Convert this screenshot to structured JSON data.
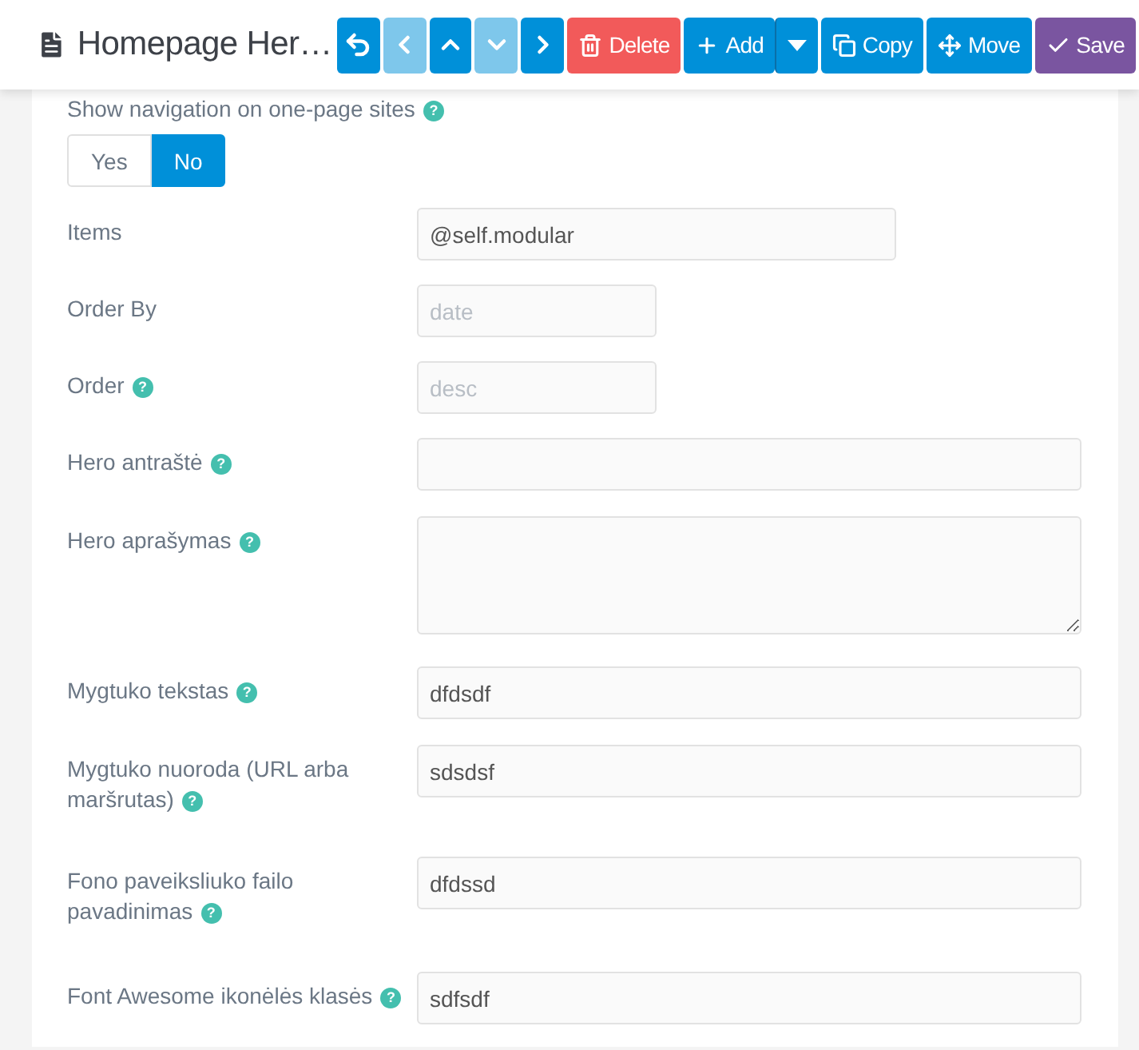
{
  "header": {
    "title": "Homepage Her…"
  },
  "toolbar": [
    {
      "kind": "back",
      "disabled": false
    },
    {
      "kind": "prev",
      "disabled": true
    },
    {
      "kind": "up",
      "disabled": false
    },
    {
      "kind": "down",
      "disabled": true
    },
    {
      "kind": "next",
      "disabled": false
    }
  ],
  "actions": [
    {
      "kind": "delete",
      "label": "Delete"
    },
    {
      "kind": "add",
      "label": "Add"
    },
    {
      "kind": "dropdown"
    },
    {
      "kind": "copy",
      "label": "Copy"
    },
    {
      "kind": "move",
      "label": "Move"
    },
    {
      "kind": "save",
      "label": "Save"
    }
  ],
  "navigation_toggle": {
    "label": "Show navigation on one-page sites",
    "help": "?",
    "options": [
      {
        "label": "Yes",
        "selected": false
      },
      {
        "label": "No",
        "selected": true
      }
    ]
  },
  "fields": [
    {
      "label": "Items",
      "kind": "medium",
      "value": "@self.modular"
    },
    {
      "label": "Order By",
      "kind": "short",
      "placeholder": "date"
    },
    {
      "label": "Order",
      "help": "?",
      "kind": "short",
      "placeholder": "desc"
    },
    {
      "label": "Hero antraštė",
      "help": "?",
      "kind": "wide"
    },
    {
      "label": "Hero aprašymas",
      "help": "?",
      "kind": "textarea"
    },
    {
      "label": "Mygtuko tekstas",
      "help": "?",
      "kind": "wide",
      "value": "dfdsdf"
    },
    {
      "label": "Mygtuko nuoroda (URL arba maršrutas)",
      "help": "?",
      "kind": "wide",
      "value": "sdsdsf"
    },
    {
      "label": "Fono paveiksliuko failo pavadinimas",
      "help": "?",
      "kind": "wide",
      "value": "dfdssd"
    },
    {
      "label": "Font Awesome ikonėlės klasės",
      "help": "?",
      "kind": "wide",
      "value": "sdfsdf"
    }
  ]
}
